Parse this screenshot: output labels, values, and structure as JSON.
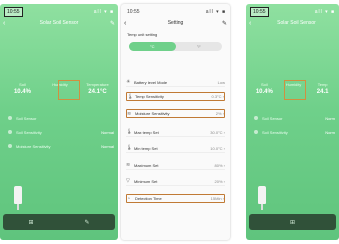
{
  "left_phone": {
    "time": "10:55",
    "status_icons": "all ▾ ■",
    "nav": {
      "back": "‹",
      "title": "Solar Soil Sensor",
      "edit": "✎"
    },
    "readings": [
      {
        "caption": "Soil",
        "value": "10.4%"
      },
      {
        "caption": "Humidity",
        "value": ""
      },
      {
        "caption": "Temperature",
        "value": "24.1°C"
      }
    ],
    "rows": [
      {
        "label": "Soil Sensor",
        "value": ""
      },
      {
        "label": "Soil Sensitivity",
        "value": "Normal"
      },
      {
        "label": "Moisture Sensitivity",
        "value": "Normal"
      }
    ],
    "bottom": [
      "⊞",
      "✎"
    ]
  },
  "middle_phone": {
    "time": "10:55",
    "status_icons": "all ▾ ■",
    "nav": {
      "back": "‹",
      "title": "Setting",
      "edit": "✎"
    },
    "temp_unit_label": "Temp unit setting",
    "temp_units": [
      "°C",
      "°F"
    ],
    "rows": [
      {
        "icon": "☀",
        "label": "Battery level Mode",
        "value": "Low"
      },
      {
        "icon": "🌡",
        "label": "Temp Sensitivity",
        "value": "0.3°C ›",
        "boxed": true
      },
      {
        "icon": "≋",
        "label": "Moisture Sensitivity",
        "value": "2% ›",
        "boxed": true
      },
      {
        "icon": "🌡",
        "label": "Max temp Set",
        "value": "30.0°C ›"
      },
      {
        "icon": "🌡",
        "label": "Min temp Set",
        "value": "10.0°C ›"
      },
      {
        "icon": "≋",
        "label": "Maximum Set",
        "value": "80% ›"
      },
      {
        "icon": "▽",
        "label": "Minimum Set",
        "value": "20% ›"
      },
      {
        "icon": "◔",
        "label": "Detection Time",
        "value": "15Min ›",
        "boxed": true
      }
    ]
  },
  "right_phone": {
    "time": "10:55",
    "status_icons": "all ▾ ■",
    "nav": {
      "back": "‹",
      "title": "Solar Soil Sensor"
    },
    "readings": [
      {
        "caption": "Soil",
        "value": "10.4%"
      },
      {
        "caption": "Humidity",
        "value": ""
      },
      {
        "caption": "Temp",
        "value": "24.1"
      }
    ],
    "rows": [
      {
        "label": "Soil Sensor",
        "value": "Norm"
      },
      {
        "label": "Soil Sensitivity",
        "value": "Norm"
      }
    ],
    "bottom": [
      "⊞"
    ]
  }
}
